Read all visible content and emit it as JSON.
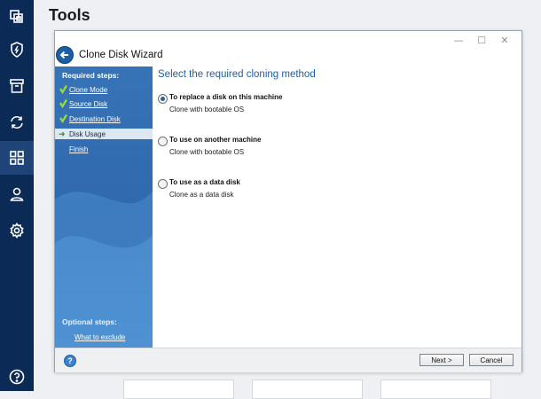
{
  "page": {
    "title": "Tools"
  },
  "dialog": {
    "title": "Clone Disk Wizard",
    "nav": {
      "required_heading": "Required steps:",
      "steps": [
        {
          "label": "Clone Mode",
          "state": "done"
        },
        {
          "label": "Source Disk",
          "state": "done"
        },
        {
          "label": "Destination Disk",
          "state": "done"
        },
        {
          "label": "Disk Usage",
          "state": "current"
        },
        {
          "label": "Finish",
          "state": "pending"
        }
      ],
      "optional_heading": "Optional steps:",
      "optional_steps": [
        {
          "label": "What to exclude"
        }
      ]
    },
    "content": {
      "heading": "Select the required cloning method",
      "options": [
        {
          "label": "To replace a disk on this machine",
          "description": "Clone with bootable OS",
          "selected": true
        },
        {
          "label": "To use on another machine",
          "description": "Clone with bootable OS",
          "selected": false
        },
        {
          "label": "To use as a data disk",
          "description": "Clone as a data disk",
          "selected": false
        }
      ]
    },
    "footer": {
      "next_label": "Next >",
      "cancel_label": "Cancel"
    },
    "window_controls": {
      "minimize": "—",
      "maximize": "☐",
      "close": "✕"
    }
  },
  "colors": {
    "sidebar_bg": "#0b2a55",
    "nav_panel": "#3773b7",
    "accent": "#1d5fa6",
    "check": "#9bdc39"
  },
  "sidebar": {
    "icons": [
      "copy-icon",
      "shield-icon",
      "archive-icon",
      "sync-icon",
      "tools-grid-icon",
      "account-icon",
      "settings-icon",
      "help-icon"
    ]
  }
}
